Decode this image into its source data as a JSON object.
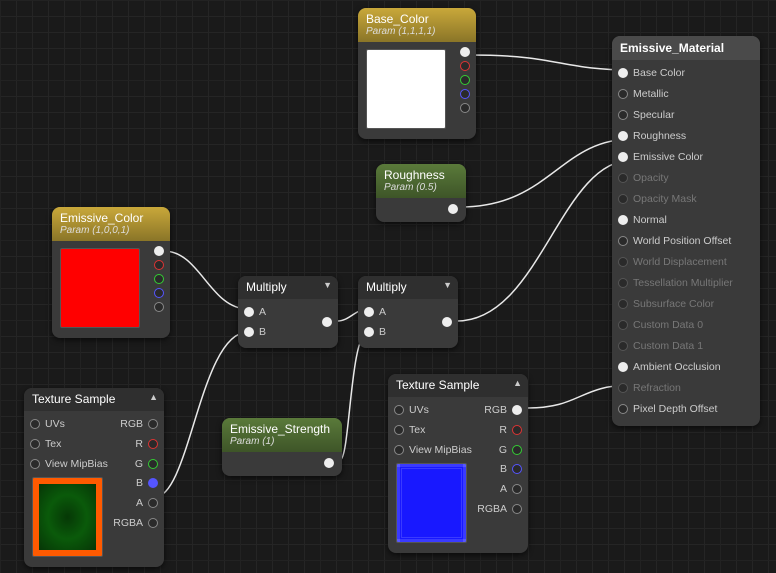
{
  "material": {
    "name": "Emissive_Material"
  },
  "nodes": {
    "base_color": {
      "title": "Base_Color",
      "subtitle": "Param (1,1,1,1)"
    },
    "roughness": {
      "title": "Roughness",
      "subtitle": "Param (0.5)"
    },
    "emissive_color": {
      "title": "Emissive_Color",
      "subtitle": "Param (1,0,0,1)"
    },
    "multiply1": {
      "title": "Multiply",
      "inA": "A",
      "inB": "B"
    },
    "multiply2": {
      "title": "Multiply",
      "inA": "A",
      "inB": "B"
    },
    "emissive_strength": {
      "title": "Emissive_Strength",
      "subtitle": "Param (1)"
    },
    "tex1": {
      "title": "Texture Sample",
      "in": {
        "uvs": "UVs",
        "tex": "Tex",
        "mip": "View MipBias"
      },
      "out": {
        "rgb": "RGB",
        "r": "R",
        "g": "G",
        "b": "B",
        "a": "A",
        "rgba": "RGBA"
      }
    },
    "tex2": {
      "title": "Texture Sample",
      "in": {
        "uvs": "UVs",
        "tex": "Tex",
        "mip": "View MipBias"
      },
      "out": {
        "rgb": "RGB",
        "r": "R",
        "g": "G",
        "b": "B",
        "a": "A",
        "rgba": "RGBA"
      }
    }
  },
  "result_pins": {
    "base_color": "Base Color",
    "metallic": "Metallic",
    "specular": "Specular",
    "roughness": "Roughness",
    "emissive": "Emissive Color",
    "opacity": "Opacity",
    "opacity_mask": "Opacity Mask",
    "normal": "Normal",
    "wpo": "World Position Offset",
    "world_disp": "World Displacement",
    "tess": "Tessellation Multiplier",
    "subsurface": "Subsurface Color",
    "cd0": "Custom Data 0",
    "cd1": "Custom Data 1",
    "ao": "Ambient Occlusion",
    "refraction": "Refraction",
    "pdo": "Pixel Depth Offset"
  }
}
